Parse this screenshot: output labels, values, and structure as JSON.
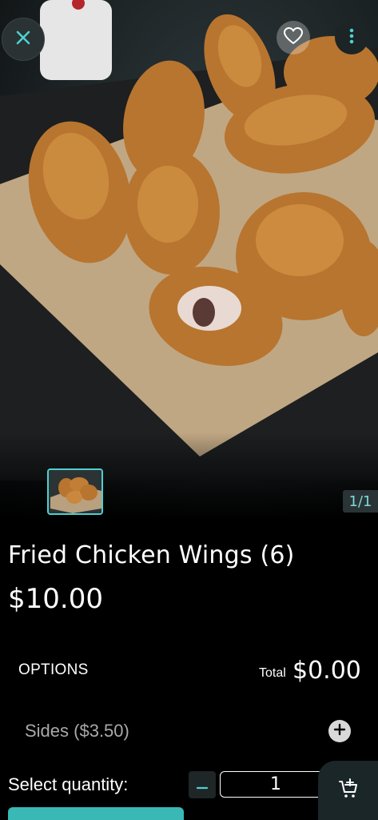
{
  "product": {
    "title": "Fried Chicken Wings (6)",
    "price": "$10.00"
  },
  "gallery": {
    "counter": "1/1"
  },
  "options": {
    "label": "OPTIONS",
    "total_label": "Total",
    "total_value": "$0.00",
    "items": [
      {
        "label": "Sides ($3.50)"
      }
    ]
  },
  "quantity": {
    "label": "Select quantity:",
    "value": "1"
  },
  "icons": {
    "close": "close-icon",
    "favorite": "heart-icon",
    "more": "more-vertical-icon",
    "add_side": "plus-circle-icon",
    "minus": "minus-icon",
    "cart": "add-to-cart-icon"
  },
  "colors": {
    "accent": "#4fd0cf",
    "button_bar": "#39b8b5",
    "background": "#000000"
  }
}
